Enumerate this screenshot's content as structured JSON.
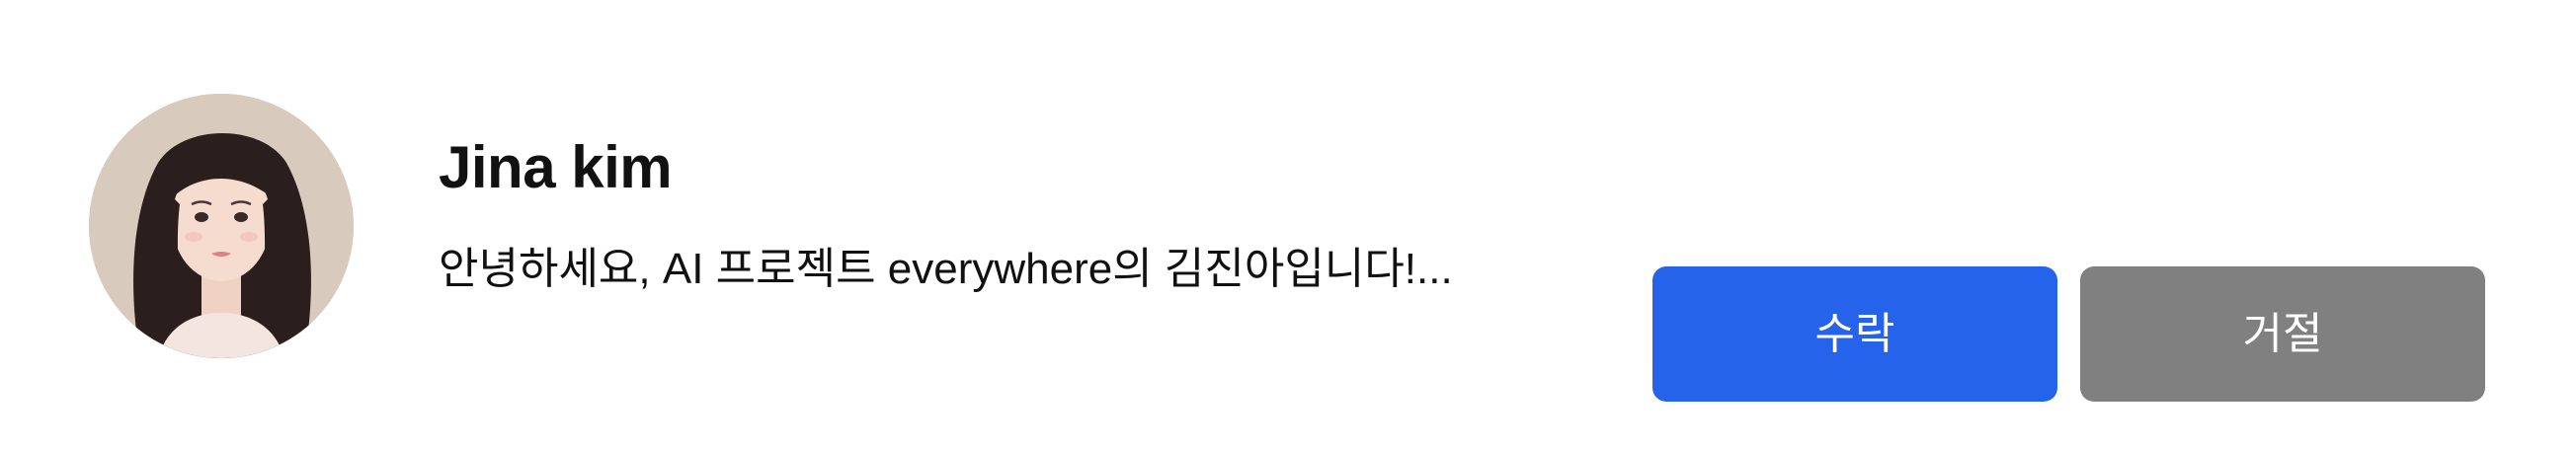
{
  "request": {
    "name": "Jina kim",
    "message": "안녕하세요, AI 프로젝트 everywhere의 김진아입니다!...",
    "avatar_icon": "profile-photo"
  },
  "actions": {
    "accept_label": "수락",
    "reject_label": "거절"
  },
  "colors": {
    "accept": "#2563eb",
    "reject": "#808080",
    "text": "#111111",
    "background": "#ffffff"
  }
}
